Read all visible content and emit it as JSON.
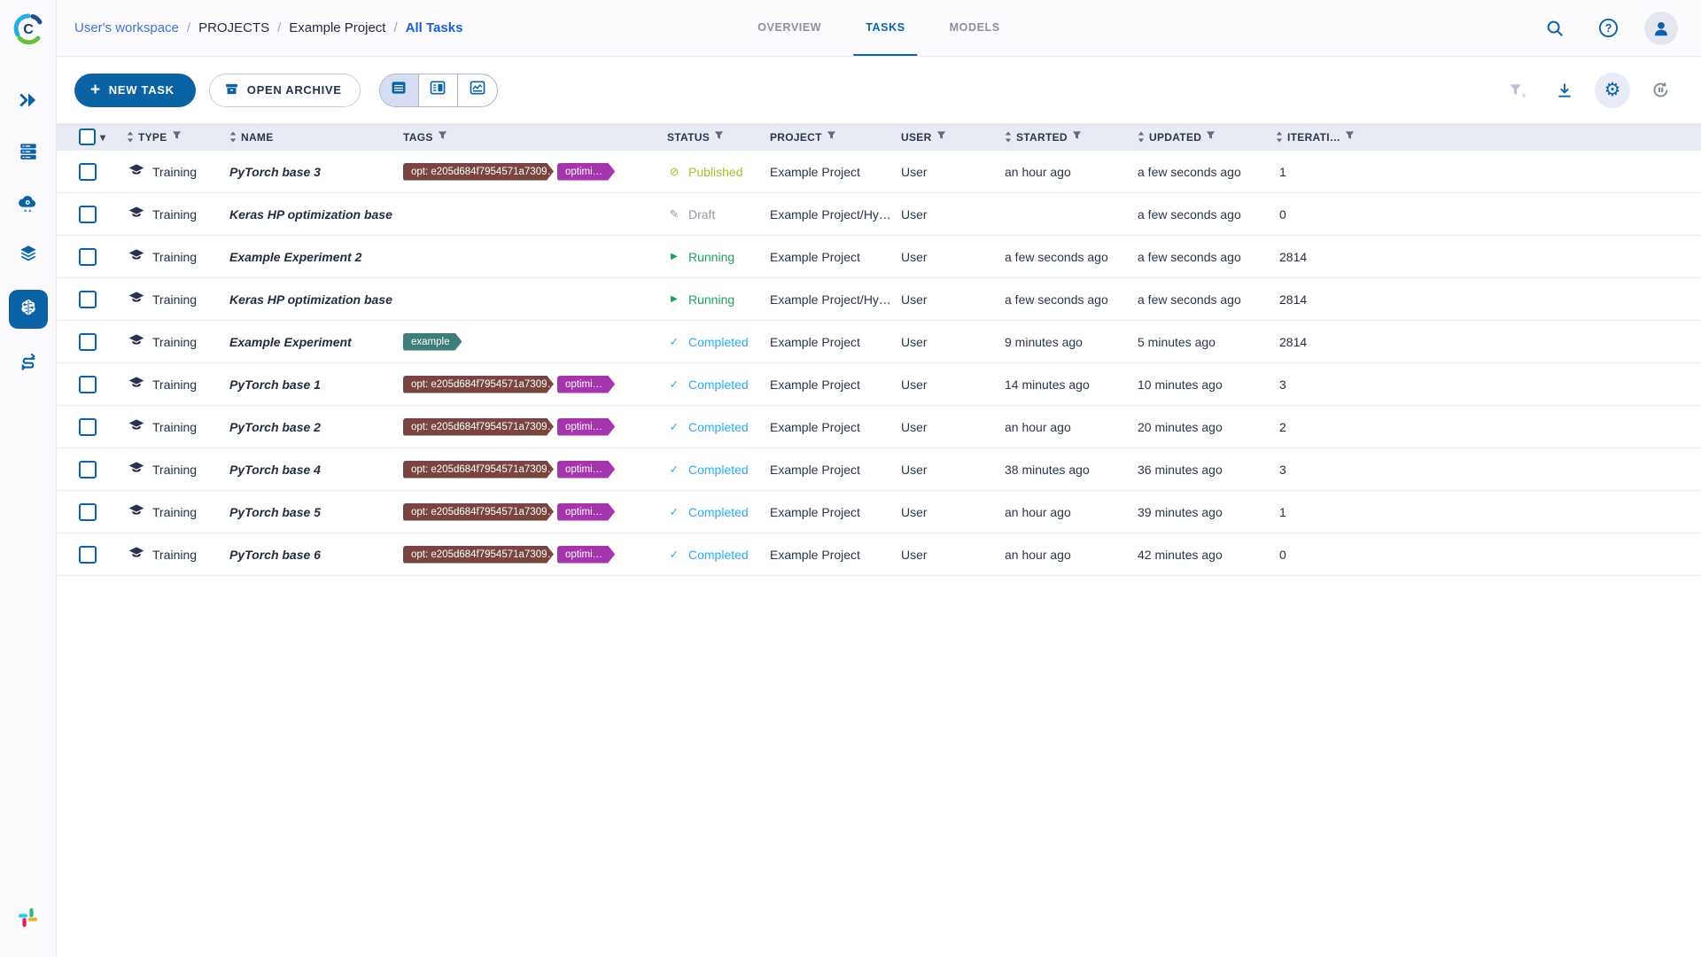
{
  "colors": {
    "primary": "#0b63a6",
    "breadcrumb_link": "#4273cf",
    "breadcrumb_active": "#1a5fd6",
    "header_bg": "#e8ebf4",
    "status": {
      "published": "#a3c128",
      "draft": "#8f99ab",
      "running": "#20a05a",
      "completed": "#2ba9f1"
    },
    "tag_maroon": "#7a4541",
    "tag_magenta": "#a435ad",
    "tag_teal": "#3f7e78"
  },
  "icon_glyphs": {
    "published-icon": "⊘",
    "draft-icon": "✎",
    "running-icon": "▶",
    "completed-icon": "✓",
    "caret-down-icon": "▾",
    "plus-icon": "+",
    "gear-icon": "⚙",
    "sort-up-icon": "▲",
    "sort-down-icon": "▼"
  },
  "sidebar": {
    "items": [
      {
        "name": "expand",
        "active": false
      },
      {
        "name": "queues",
        "active": false
      },
      {
        "name": "cloud-services",
        "active": false
      },
      {
        "name": "datasets",
        "active": false
      },
      {
        "name": "projects",
        "active": true
      },
      {
        "name": "pipelines",
        "active": false
      }
    ],
    "footer": [
      {
        "name": "slack"
      }
    ]
  },
  "breadcrumb": {
    "separator": "/",
    "items": [
      {
        "label": "User's workspace",
        "style": "link"
      },
      {
        "label": "PROJECTS",
        "style": "plain"
      },
      {
        "label": "Example Project",
        "style": "plain"
      },
      {
        "label": "All Tasks",
        "style": "active"
      }
    ]
  },
  "tabs": [
    {
      "label": "OVERVIEW",
      "active": false
    },
    {
      "label": "TASKS",
      "active": true
    },
    {
      "label": "MODELS",
      "active": false
    }
  ],
  "toolbar": {
    "new_task_label": "NEW TASK",
    "open_archive_label": "OPEN ARCHIVE",
    "views": [
      "table-view",
      "detail-view",
      "compare-view"
    ],
    "active_view": "table-view",
    "right_icons": [
      "clear-filters",
      "download",
      "settings",
      "auto-refresh"
    ]
  },
  "table": {
    "headers": [
      {
        "id": "select",
        "type": "select"
      },
      {
        "id": "type",
        "label": "TYPE",
        "sort": true,
        "filter": true
      },
      {
        "id": "name",
        "label": "NAME",
        "sort": true,
        "filter": false
      },
      {
        "id": "tags",
        "label": "TAGS",
        "sort": false,
        "filter": true
      },
      {
        "id": "status",
        "label": "STATUS",
        "sort": false,
        "filter": true
      },
      {
        "id": "project",
        "label": "PROJECT",
        "sort": false,
        "filter": true
      },
      {
        "id": "user",
        "label": "USER",
        "sort": false,
        "filter": true
      },
      {
        "id": "started",
        "label": "STARTED",
        "sort": true,
        "filter": true
      },
      {
        "id": "updated",
        "label": "UPDATED",
        "sort": true,
        "filter": true
      },
      {
        "id": "iterations",
        "label": "ITERATI…",
        "sort": true,
        "filter": true
      }
    ],
    "rows": [
      {
        "type": "Training",
        "name": "PyTorch base 3",
        "tags": [
          {
            "text": "opt: e205d684f7954571a7309…",
            "color": "#7a4541"
          },
          {
            "text": "optimi…",
            "color": "#a435ad"
          }
        ],
        "status": {
          "key": "published",
          "label": "Published"
        },
        "project": "Example Project",
        "user": "User",
        "started": "an hour ago",
        "updated": "a few seconds ago",
        "iterations": "1"
      },
      {
        "type": "Training",
        "name": "Keras HP optimization base",
        "tags": [],
        "status": {
          "key": "draft",
          "label": "Draft"
        },
        "project": "Example Project/Hy…",
        "user": "User",
        "started": "",
        "updated": "a few seconds ago",
        "iterations": "0"
      },
      {
        "type": "Training",
        "name": "Example Experiment 2",
        "tags": [],
        "status": {
          "key": "running",
          "label": "Running"
        },
        "project": "Example Project",
        "user": "User",
        "started": "a few seconds ago",
        "updated": "a few seconds ago",
        "iterations": "2814"
      },
      {
        "type": "Training",
        "name": "Keras HP optimization base",
        "tags": [],
        "status": {
          "key": "running",
          "label": "Running"
        },
        "project": "Example Project/Hy…",
        "user": "User",
        "started": "a few seconds ago",
        "updated": "a few seconds ago",
        "iterations": "2814"
      },
      {
        "type": "Training",
        "name": "Example Experiment",
        "tags": [
          {
            "text": "example",
            "color": "#3f7e78"
          }
        ],
        "status": {
          "key": "completed",
          "label": "Completed"
        },
        "project": "Example Project",
        "user": "User",
        "started": "9 minutes ago",
        "updated": "5 minutes ago",
        "iterations": "2814"
      },
      {
        "type": "Training",
        "name": "PyTorch base 1",
        "tags": [
          {
            "text": "opt: e205d684f7954571a7309…",
            "color": "#7a4541"
          },
          {
            "text": "optimi…",
            "color": "#a435ad"
          }
        ],
        "status": {
          "key": "completed",
          "label": "Completed"
        },
        "project": "Example Project",
        "user": "User",
        "started": "14 minutes ago",
        "updated": "10 minutes ago",
        "iterations": "3"
      },
      {
        "type": "Training",
        "name": "PyTorch base 2",
        "tags": [
          {
            "text": "opt: e205d684f7954571a7309…",
            "color": "#7a4541"
          },
          {
            "text": "optimi…",
            "color": "#a435ad"
          }
        ],
        "status": {
          "key": "completed",
          "label": "Completed"
        },
        "project": "Example Project",
        "user": "User",
        "started": "an hour ago",
        "updated": "20 minutes ago",
        "iterations": "2"
      },
      {
        "type": "Training",
        "name": "PyTorch base 4",
        "tags": [
          {
            "text": "opt: e205d684f7954571a7309…",
            "color": "#7a4541"
          },
          {
            "text": "optimi…",
            "color": "#a435ad"
          }
        ],
        "status": {
          "key": "completed",
          "label": "Completed"
        },
        "project": "Example Project",
        "user": "User",
        "started": "38 minutes ago",
        "updated": "36 minutes ago",
        "iterations": "3"
      },
      {
        "type": "Training",
        "name": "PyTorch base 5",
        "tags": [
          {
            "text": "opt: e205d684f7954571a7309…",
            "color": "#7a4541"
          },
          {
            "text": "optimi…",
            "color": "#a435ad"
          }
        ],
        "status": {
          "key": "completed",
          "label": "Completed"
        },
        "project": "Example Project",
        "user": "User",
        "started": "an hour ago",
        "updated": "39 minutes ago",
        "iterations": "1"
      },
      {
        "type": "Training",
        "name": "PyTorch base 6",
        "tags": [
          {
            "text": "opt: e205d684f7954571a7309…",
            "color": "#7a4541"
          },
          {
            "text": "optimi…",
            "color": "#a435ad"
          }
        ],
        "status": {
          "key": "completed",
          "label": "Completed"
        },
        "project": "Example Project",
        "user": "User",
        "started": "an hour ago",
        "updated": "42 minutes ago",
        "iterations": "0"
      }
    ]
  }
}
